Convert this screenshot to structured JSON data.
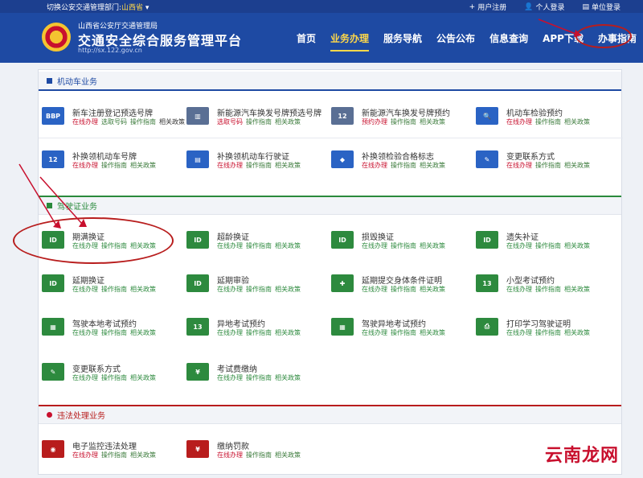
{
  "topbar": {
    "location_prefix": "切换公安交通管理部门:",
    "province": "山西省",
    "register": "用户注册",
    "personal_login": "个人登录",
    "unit_login": "单位登录"
  },
  "header": {
    "subtitle": "山西省公安厅交通管理局",
    "title": "交通安全综合服务管理平台",
    "url": "http://sx.122.gov.cn",
    "nav": [
      "首页",
      "业务办理",
      "服务导航",
      "公告公布",
      "信息查询",
      "APP下载",
      "办事指南"
    ]
  },
  "sections": {
    "vehicle": "机动车业务",
    "driver": "驾驶证业务",
    "violation": "违法处理业务"
  },
  "vehicle_items": [
    {
      "name": "新车注册登记预选号牌",
      "links": [
        "在线办理",
        "选取号码",
        "操作指南",
        "相关政策"
      ]
    },
    {
      "name": "新能源汽车换发号牌预选号牌",
      "links": [
        "选取号码",
        "操作指南",
        "相关政策"
      ]
    },
    {
      "name": "新能源汽车换发号牌预约",
      "links": [
        "预约办理",
        "操作指南",
        "相关政策"
      ]
    },
    {
      "name": "机动车检验预约",
      "links": [
        "在线办理",
        "操作指南",
        "相关政策"
      ]
    },
    {
      "name": "补换领机动车号牌",
      "links": [
        "在线办理",
        "操作指南",
        "相关政策"
      ]
    },
    {
      "name": "补换领机动车行驶证",
      "links": [
        "在线办理",
        "操作指南",
        "相关政策"
      ]
    },
    {
      "name": "补换领检验合格标志",
      "links": [
        "在线办理",
        "操作指南",
        "相关政策"
      ]
    },
    {
      "name": "变更联系方式",
      "links": [
        "在线办理",
        "操作指南",
        "相关政策"
      ]
    }
  ],
  "driver_items": [
    {
      "name": "期满换证",
      "links": [
        "在线办理",
        "操作指南",
        "相关政策"
      ]
    },
    {
      "name": "超龄换证",
      "links": [
        "在线办理",
        "操作指南",
        "相关政策"
      ]
    },
    {
      "name": "损毁换证",
      "links": [
        "在线办理",
        "操作指南",
        "相关政策"
      ]
    },
    {
      "name": "遗失补证",
      "links": [
        "在线办理",
        "操作指南",
        "相关政策"
      ]
    },
    {
      "name": "延期换证",
      "links": [
        "在线办理",
        "操作指南",
        "相关政策"
      ]
    },
    {
      "name": "延期审验",
      "links": [
        "在线办理",
        "操作指南",
        "相关政策"
      ]
    },
    {
      "name": "延期提交身体条件证明",
      "links": [
        "在线办理",
        "操作指南",
        "相关政策"
      ]
    },
    {
      "name": "小型考试预约",
      "links": [
        "在线办理",
        "操作指南",
        "相关政策"
      ]
    },
    {
      "name": "驾驶本地考试预约",
      "links": [
        "在线办理",
        "操作指南",
        "相关政策"
      ]
    },
    {
      "name": "异地考试预约",
      "links": [
        "在线办理",
        "操作指南",
        "相关政策"
      ]
    },
    {
      "name": "驾驶异地考试预约",
      "links": [
        "在线办理",
        "操作指南",
        "相关政策"
      ]
    },
    {
      "name": "打印学习驾驶证明",
      "links": [
        "在线办理",
        "操作指南",
        "相关政策"
      ]
    },
    {
      "name": "变更联系方式",
      "links": [
        "在线办理",
        "操作指南",
        "相关政策"
      ]
    },
    {
      "name": "考试费缴纳",
      "links": [
        "在线办理",
        "操作指南",
        "相关政策"
      ]
    }
  ],
  "violation_items": [
    {
      "name": "电子监控违法处理",
      "links": [
        "在线办理",
        "操作指南",
        "相关政策"
      ]
    },
    {
      "name": "缴纳罚款",
      "links": [
        "在线办理",
        "操作指南",
        "相关政策"
      ]
    }
  ],
  "watermark": "云南龙网",
  "colors": {
    "header_blue": "#1e4aa3",
    "accent_yellow": "#ffd84a",
    "green": "#2d8a3e",
    "red": "#c8102e"
  }
}
